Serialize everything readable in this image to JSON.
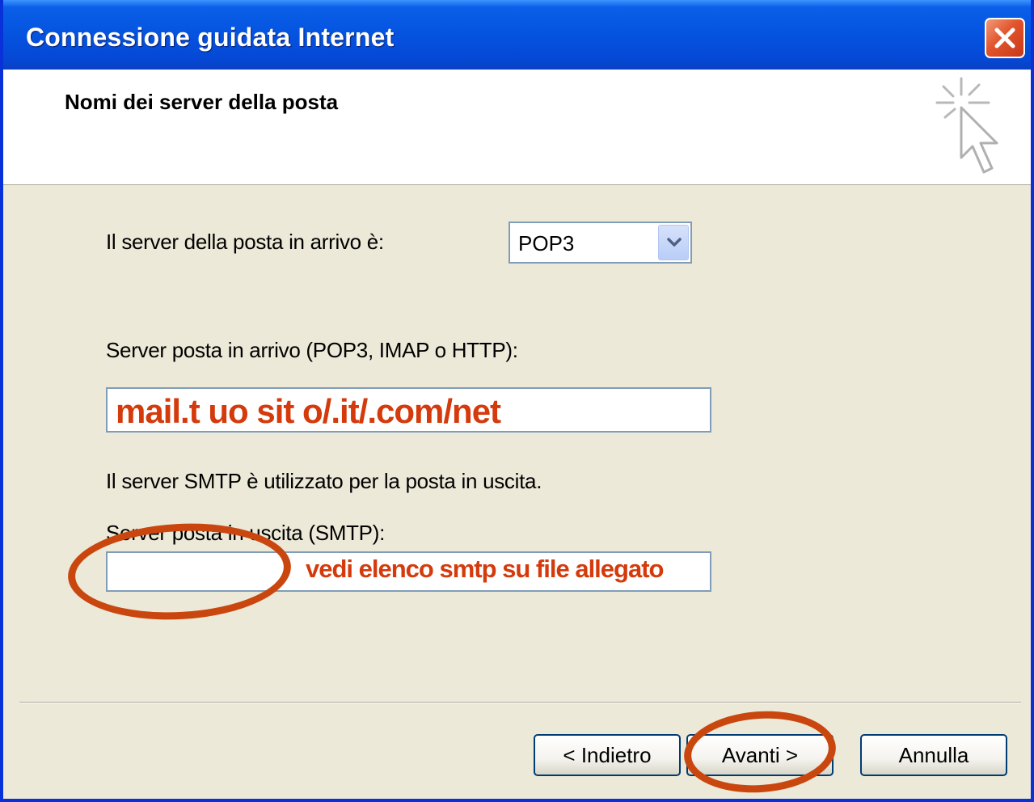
{
  "window": {
    "title": "Connessione guidata Internet",
    "close_icon": "close-icon"
  },
  "header": {
    "title": "Nomi dei server della posta",
    "icon": "wizard-cursor-icon"
  },
  "incoming_type": {
    "label": "Il server della posta in arrivo è:",
    "selected": "POP3"
  },
  "incoming_server": {
    "label": "Server posta in arrivo (POP3, IMAP o HTTP):",
    "value": "mail.t uo sit o/.it/.com/net"
  },
  "smtp_info": "Il server SMTP è utilizzato per la posta in uscita.",
  "outgoing_server": {
    "label": "Server posta in uscita (SMTP):",
    "value": "",
    "annotation": "vedi elenco smtp su file allegato"
  },
  "buttons": {
    "back": "< Indietro",
    "next": "Avanti >",
    "cancel": "Annulla"
  },
  "colors": {
    "annotation": "#d43a0c",
    "titlebar": "#0554e0"
  }
}
